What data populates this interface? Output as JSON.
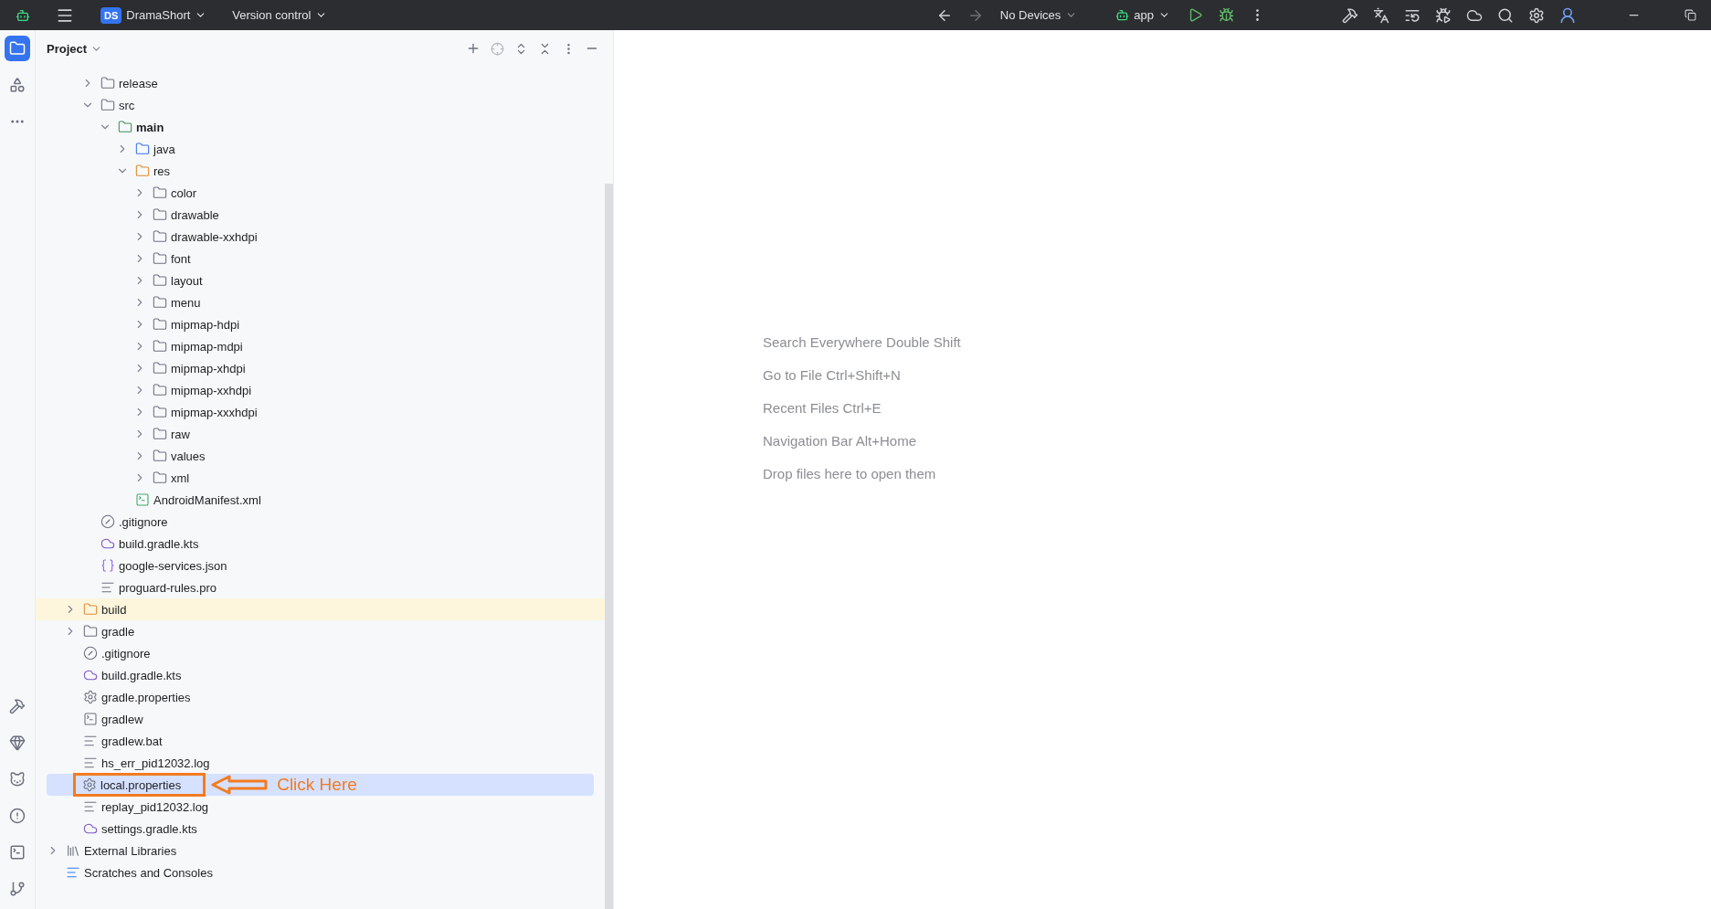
{
  "title_bar": {
    "project_badge": "DS",
    "project": "DramaShort",
    "vcs": "Version control",
    "device": "No Devices",
    "config": "app"
  },
  "tool_windows_top": [
    {
      "selected": true
    },
    {
      "selected": false
    },
    {
      "selected": false
    }
  ],
  "tool_windows_bottom": [
    {
      "selected": false
    },
    {
      "selected": false
    },
    {
      "selected": false
    },
    {
      "selected": false
    },
    {
      "selected": false
    },
    {
      "selected": false
    }
  ],
  "project_panel": {
    "title": "Project",
    "tree": [
      {
        "children": [
          {
            "children": [
              {
                "label": "release",
                "kind": "folder",
                "expanded": false
              },
              {
                "label": "src",
                "kind": "folder",
                "expanded": true,
                "children": [
                  {
                    "label": "main",
                    "kind": "module",
                    "expanded": true,
                    "bold": true,
                    "children": [
                      {
                        "label": "java",
                        "kind": "source",
                        "expanded": false
                      },
                      {
                        "label": "res",
                        "kind": "resources",
                        "expanded": true,
                        "children": [
                          {
                            "label": "color",
                            "kind": "folder",
                            "expanded": false
                          },
                          {
                            "label": "drawable",
                            "kind": "folder",
                            "expanded": false
                          },
                          {
                            "label": "drawable-xxhdpi",
                            "kind": "folder",
                            "expanded": false
                          },
                          {
                            "label": "font",
                            "kind": "folder",
                            "expanded": false
                          },
                          {
                            "label": "layout",
                            "kind": "folder",
                            "expanded": false
                          },
                          {
                            "label": "menu",
                            "kind": "folder",
                            "expanded": false
                          },
                          {
                            "label": "mipmap-hdpi",
                            "kind": "folder",
                            "expanded": false
                          },
                          {
                            "label": "mipmap-mdpi",
                            "kind": "folder",
                            "expanded": false
                          },
                          {
                            "label": "mipmap-xhdpi",
                            "kind": "folder",
                            "expanded": false
                          },
                          {
                            "label": "mipmap-xxhdpi",
                            "kind": "folder",
                            "expanded": false
                          },
                          {
                            "label": "mipmap-xxxhdpi",
                            "kind": "folder",
                            "expanded": false
                          },
                          {
                            "label": "raw",
                            "kind": "folder",
                            "expanded": false
                          },
                          {
                            "label": "values",
                            "kind": "folder",
                            "expanded": false
                          },
                          {
                            "label": "xml",
                            "kind": "folder",
                            "expanded": false
                          }
                        ]
                      },
                      {
                        "label": "AndroidManifest.xml",
                        "kind": "manifest"
                      }
                    ]
                  }
                ]
              },
              {
                "label": ".gitignore",
                "kind": "ignore"
              },
              {
                "label": "build.gradle.kts",
                "kind": "gradle"
              },
              {
                "label": "google-services.json",
                "kind": "json"
              },
              {
                "label": "proguard-rules.pro",
                "kind": "text"
              }
            ]
          },
          {
            "label": "build",
            "kind": "excluded",
            "expanded": false,
            "highlighted": true
          },
          {
            "label": "gradle",
            "kind": "folder",
            "expanded": false
          },
          {
            "label": ".gitignore",
            "kind": "ignore"
          },
          {
            "label": "build.gradle.kts",
            "kind": "gradle"
          },
          {
            "label": "gradle.properties",
            "kind": "gear"
          },
          {
            "label": "gradlew",
            "kind": "terminal"
          },
          {
            "label": "gradlew.bat",
            "kind": "text"
          },
          {
            "label": "hs_err_pid12032.log",
            "kind": "text"
          },
          {
            "label": "local.properties",
            "kind": "gear",
            "selected": true,
            "annotation": {
              "text": "Click Here"
            }
          },
          {
            "label": "replay_pid12032.log",
            "kind": "text"
          },
          {
            "label": "settings.gradle.kts",
            "kind": "gradle"
          }
        ]
      },
      {
        "label": "External Libraries",
        "kind": "library",
        "expanded": false
      },
      {
        "label": "Scratches and Consoles",
        "kind": "scratches"
      }
    ]
  },
  "editor_hints": [
    "Search Everywhere Double Shift",
    "Go to File Ctrl+Shift+N",
    "Recent Files Ctrl+E",
    "Navigation Bar Alt+Home",
    "Drop files here to open them"
  ]
}
